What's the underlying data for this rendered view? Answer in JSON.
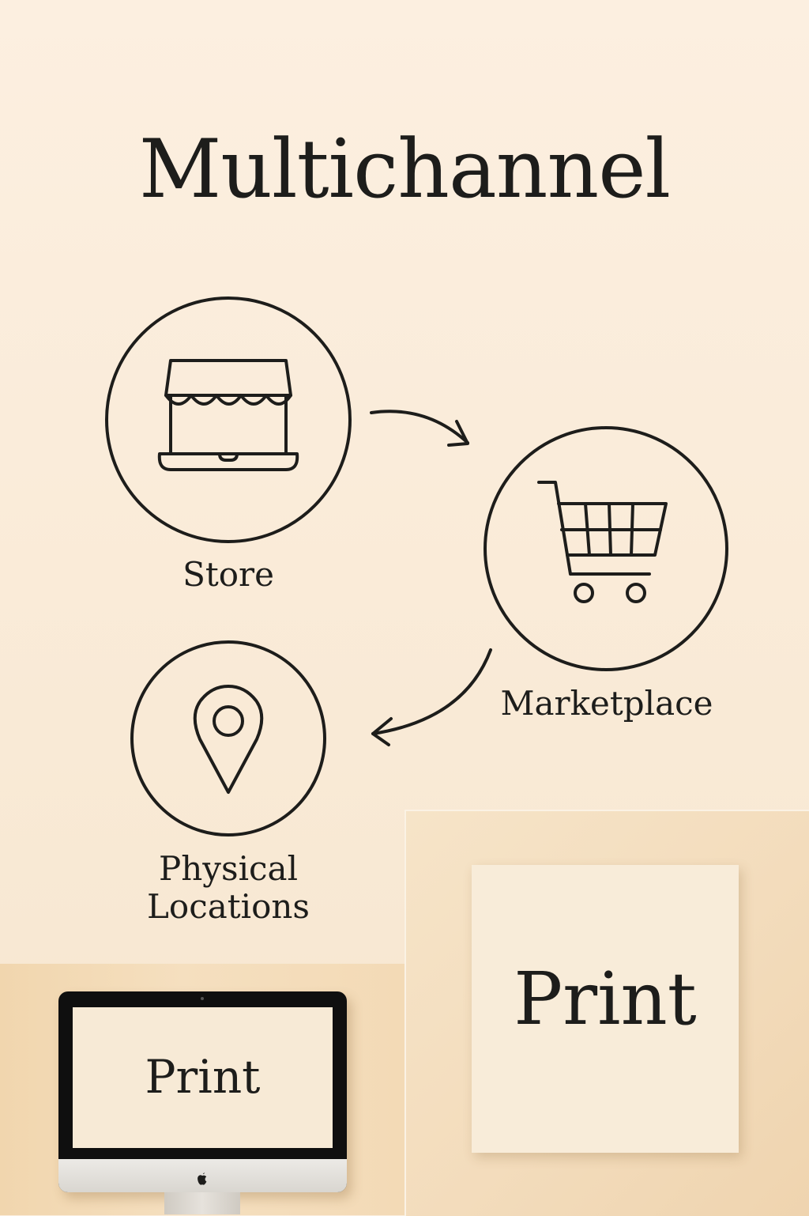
{
  "title": "Multichannel",
  "nodes": [
    {
      "label": "Store",
      "icon": "storefront-laptop-icon"
    },
    {
      "label": "Marketplace",
      "icon": "shopping-cart-icon"
    },
    {
      "label_line1": "Physical",
      "label_line2": "Locations",
      "icon": "map-pin-icon"
    }
  ],
  "print_monitor": {
    "screen_text": "Print",
    "logo_icon": "apple-logo-icon"
  },
  "print_card": {
    "text": "Print"
  },
  "colors": {
    "background": "#fbeedd",
    "ink": "#1d1d1b",
    "panel_left": "#f3dab6",
    "panel_right": "#f3dcbc"
  }
}
